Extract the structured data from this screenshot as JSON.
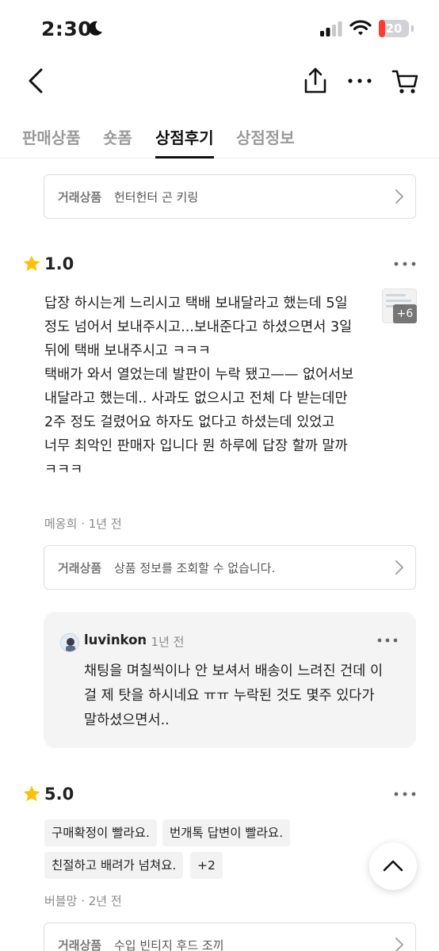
{
  "status_bar": {
    "time": "2:30",
    "battery": "20",
    "battery_level": 0.2,
    "battery_color": "#ff3b30"
  },
  "nav": {
    "back_icon": "chevron-left-icon",
    "share_icon": "share-icon",
    "more_icon": "more-horizontal-icon",
    "cart_icon": "cart-icon"
  },
  "tabs": [
    {
      "label": "판매상품",
      "active": false
    },
    {
      "label": "숏폼",
      "active": false
    },
    {
      "label": "상점후기",
      "active": true
    },
    {
      "label": "상점정보",
      "active": false
    }
  ],
  "top_product": {
    "label": "거래상품",
    "name": "헌터헌터 곤 키링"
  },
  "reviews": [
    {
      "rating": "1.0",
      "body_lines": [
        "답장 하시는게 느리시고  택배 보내달라고 했는데 5일",
        "정도 넘어서 보내주시고...보내준다고 하셨으면서 3일",
        "뒤에 택배 보내주시고 ㅋㅋㅋ",
        "택배가 와서 열었는데 발판이 누락 됐고—— 없어서보",
        "내달라고 했는데.. 사과도 없으시고 전체 다 받는데만",
        "2주 정도 걸렸어요  하자도 없다고 하셨는데 있었고",
        "너무 최악인 판매자 입니다  뭔 하루에 답장 할까 말까",
        "ㅋㅋㅋ"
      ],
      "photo_extra": "+6",
      "author": "메옹희",
      "time": "· 1년 전",
      "product": {
        "label": "거래상품",
        "name": "상품 정보를 조회할 수 없습니다."
      },
      "reply": {
        "user": "luvinkon",
        "time": "· 1년 전",
        "lines": [
          "채팅을 며칠씩이나 안 보셔서 배송이 느려진 건데 이",
          "걸 제 탓을 하시네요 ㅠㅠ 누락된 것도 몇주 있다가",
          "말하셨으면서.."
        ]
      }
    },
    {
      "rating": "5.0",
      "tags": [
        "구매확정이 빨라요.",
        "번개톡 답변이 빨라요.",
        "친절하고 배려가 넘쳐요.",
        "+2"
      ],
      "author": "버블망",
      "time": "· 2년 전",
      "product": {
        "label": "거래상품",
        "name": "수입 빈티지 후드 조끼"
      }
    }
  ],
  "colors": {
    "star": "#ffc107",
    "accent_text": "#111111",
    "muted": "#8a8a8a"
  },
  "fab_icon": "chevron-up-icon"
}
